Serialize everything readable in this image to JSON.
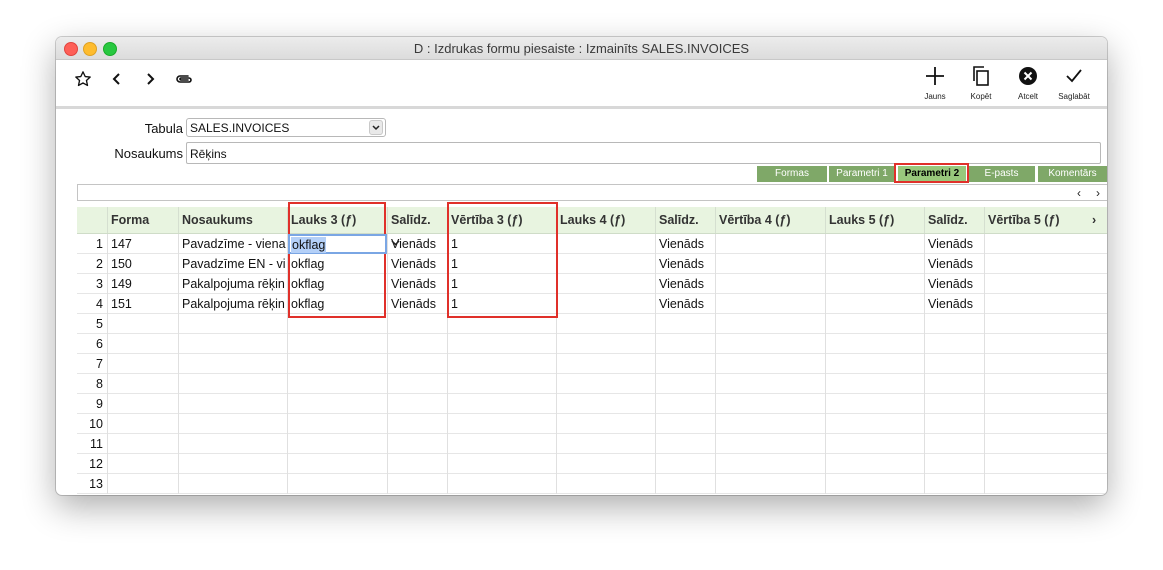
{
  "window": {
    "title": "D : Izdrukas formu piesaiste : Izmainīts SALES.INVOICES"
  },
  "toolbar": {
    "icons": [
      "star-icon",
      "chevron-left-icon",
      "chevron-right-icon",
      "paperclip-icon"
    ],
    "buttons": [
      {
        "name": "new",
        "label": "Jauns",
        "icon": "plus-icon"
      },
      {
        "name": "copy",
        "label": "Kopēt",
        "icon": "copy-icon"
      },
      {
        "name": "cancel",
        "label": "Atcelt",
        "icon": "cancel-circle-icon"
      },
      {
        "name": "save",
        "label": "Saglabāt",
        "icon": "checkmark-icon"
      }
    ]
  },
  "form": {
    "table_label": "Tabula",
    "table_value": "SALES.INVOICES",
    "name_label": "Nosaukums",
    "name_value": "Rēķins"
  },
  "tabs": [
    {
      "label": "Formas",
      "active": false
    },
    {
      "label": "Parametri 1",
      "active": false
    },
    {
      "label": "Parametri 2",
      "active": true
    },
    {
      "label": "E-pasts",
      "active": false
    },
    {
      "label": "Komentārs",
      "active": false
    }
  ],
  "grid": {
    "columns": [
      "Forma",
      "Nosaukums",
      "Lauks 3 (ƒ)",
      "Salīdz.",
      "Vērtība 3 (ƒ)",
      "Lauks 4 (ƒ)",
      "Salīdz.",
      "Vērtība 4 (ƒ)",
      "Lauks 5 (ƒ)",
      "Salīdz.",
      "Vērtība 5 (ƒ)"
    ],
    "more_columns_indicator": "›",
    "rows": [
      {
        "num": "1",
        "cells": [
          "147",
          "Pavadzīme - viena",
          "okflag",
          "Vienāds",
          "1",
          "",
          "Vienāds",
          "",
          "",
          "Vienāds",
          ""
        ]
      },
      {
        "num": "2",
        "cells": [
          "150",
          "Pavadzīme EN - vi",
          "okflag",
          "Vienāds",
          "1",
          "",
          "Vienāds",
          "",
          "",
          "Vienāds",
          ""
        ]
      },
      {
        "num": "3",
        "cells": [
          "149",
          "Pakalpojuma rēķin",
          "okflag",
          "Vienāds",
          "1",
          "",
          "Vienāds",
          "",
          "",
          "Vienāds",
          ""
        ]
      },
      {
        "num": "4",
        "cells": [
          "151",
          "Pakalpojuma rēķin",
          "okflag",
          "Vienāds",
          "1",
          "",
          "Vienāds",
          "",
          "",
          "Vienāds",
          ""
        ]
      },
      {
        "num": "5",
        "cells": [
          "",
          "",
          "",
          "",
          "",
          "",
          "",
          "",
          "",
          "",
          ""
        ]
      },
      {
        "num": "6",
        "cells": [
          "",
          "",
          "",
          "",
          "",
          "",
          "",
          "",
          "",
          "",
          ""
        ]
      },
      {
        "num": "7",
        "cells": [
          "",
          "",
          "",
          "",
          "",
          "",
          "",
          "",
          "",
          "",
          ""
        ]
      },
      {
        "num": "8",
        "cells": [
          "",
          "",
          "",
          "",
          "",
          "",
          "",
          "",
          "",
          "",
          ""
        ]
      },
      {
        "num": "9",
        "cells": [
          "",
          "",
          "",
          "",
          "",
          "",
          "",
          "",
          "",
          "",
          ""
        ]
      },
      {
        "num": "10",
        "cells": [
          "",
          "",
          "",
          "",
          "",
          "",
          "",
          "",
          "",
          "",
          ""
        ]
      },
      {
        "num": "11",
        "cells": [
          "",
          "",
          "",
          "",
          "",
          "",
          "",
          "",
          "",
          "",
          ""
        ]
      },
      {
        "num": "12",
        "cells": [
          "",
          "",
          "",
          "",
          "",
          "",
          "",
          "",
          "",
          "",
          ""
        ]
      },
      {
        "num": "13",
        "cells": [
          "",
          "",
          "",
          "",
          "",
          "",
          "",
          "",
          "",
          "",
          ""
        ]
      }
    ],
    "active_cell_value": "okflag"
  },
  "colors": {
    "tab_bg": "#7fa868",
    "tab_active_bg": "#98c87c",
    "header_bg": "#e8f4e0",
    "highlight_border": "#e0302a",
    "editor_border": "#7aa6e4"
  }
}
